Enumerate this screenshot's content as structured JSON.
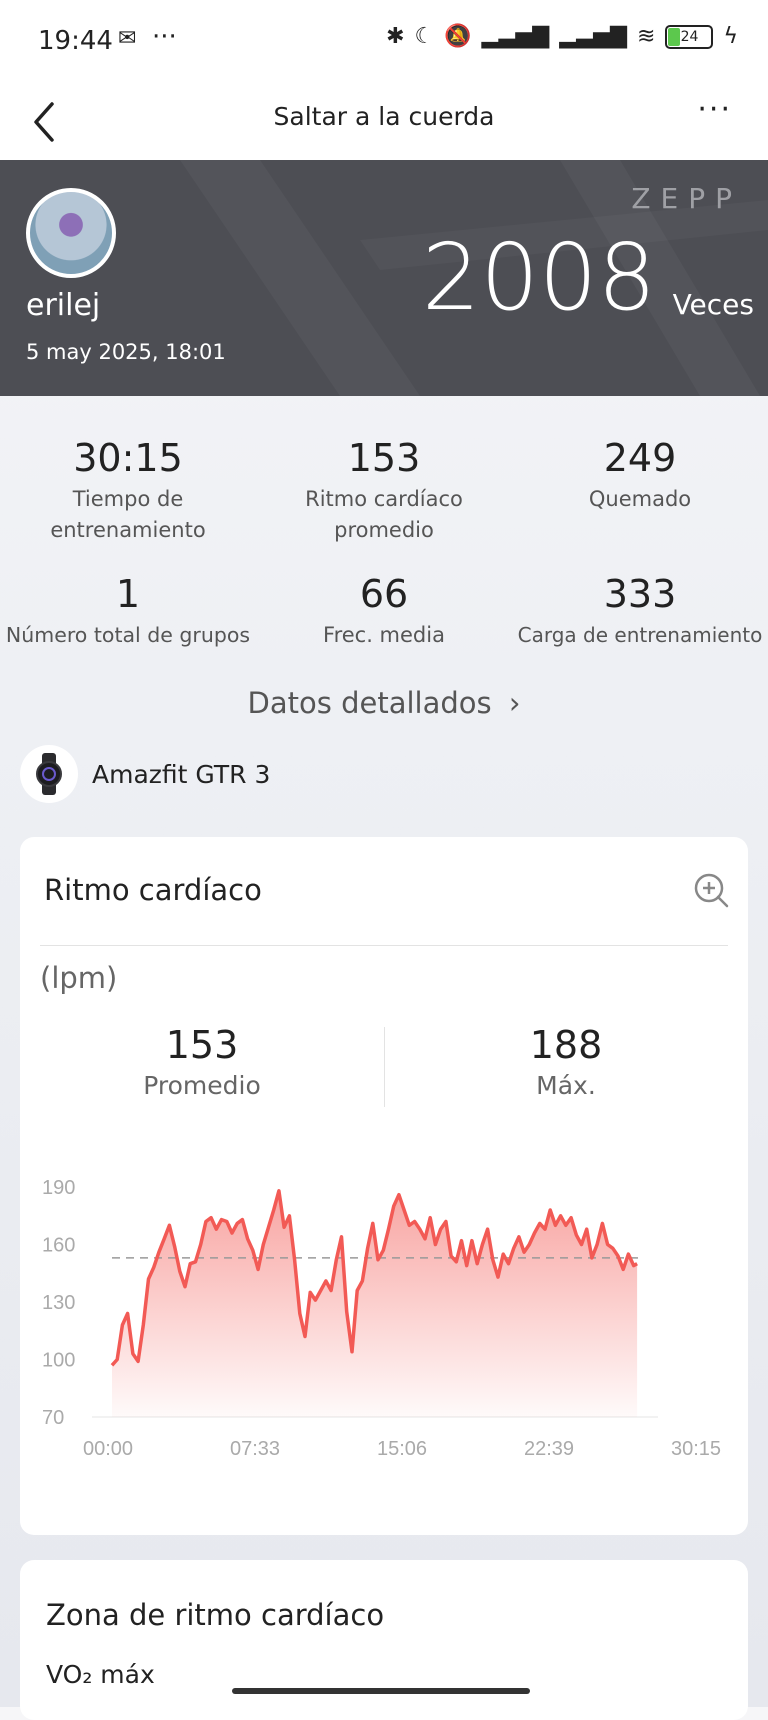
{
  "status_bar": {
    "time": "19:44",
    "notification_icon": "envelope-x-icon",
    "more_icon": "···",
    "battery_level": "24",
    "icons": [
      "bluetooth-icon",
      "moon-icon",
      "mute-icon",
      "signal-icon",
      "signal-icon",
      "wifi-icon",
      "battery-icon",
      "charging-icon"
    ]
  },
  "header": {
    "title": "Saltar a la cuerda",
    "more": "···"
  },
  "banner": {
    "username": "erilej",
    "date": "5 may 2025, 18:01",
    "logo": "ZEPP",
    "count": "2008",
    "count_unit": "Veces"
  },
  "stats": [
    {
      "value": "30:15",
      "label": "Tiempo de entrenamiento"
    },
    {
      "value": "153",
      "label": "Ritmo cardíaco promedio"
    },
    {
      "value": "249",
      "label": "Quemado"
    },
    {
      "value": "1",
      "label": "Número total de grupos"
    },
    {
      "value": "66",
      "label": "Frec. media"
    },
    {
      "value": "333",
      "label": "Carga de entrenamiento"
    }
  ],
  "detail_link": "Datos detallados",
  "device": {
    "name": "Amazfit GTR 3"
  },
  "heart_rate_card": {
    "title": "Ritmo cardíaco",
    "unit": "(lpm)",
    "average_value": "153",
    "average_label": "Promedio",
    "max_value": "188",
    "max_label": "Máx."
  },
  "zone_card": {
    "title": "Zona de ritmo cardíaco",
    "subtitle": "VO₂ máx"
  },
  "colors": {
    "accent": "#f25a55",
    "banner_bg": "#4d4e54"
  },
  "chart_data": {
    "type": "area",
    "ylim": [
      70,
      190
    ],
    "yticks": [
      "190",
      "160",
      "130",
      "100",
      "70"
    ],
    "xticks": [
      "00:00",
      "07:33",
      "15:06",
      "22:39",
      "30:15"
    ],
    "xlim_minutes": [
      0,
      30.25
    ],
    "average_line": 153,
    "series": [
      {
        "x": [
          0.0,
          0.3,
          0.6,
          0.9,
          1.2,
          1.5,
          1.8,
          2.1,
          2.4,
          2.7,
          3.0,
          3.3,
          3.6,
          3.9,
          4.2,
          4.5,
          4.8,
          5.1,
          5.4,
          5.7,
          6.0,
          6.3,
          6.6,
          6.9,
          7.2,
          7.5,
          7.8,
          8.1,
          8.4,
          8.7,
          9.0,
          9.3,
          9.6,
          9.9,
          10.2,
          10.5,
          10.8,
          11.1,
          11.4,
          11.7,
          12.0,
          12.3,
          12.6,
          12.9,
          13.2,
          13.5,
          13.8,
          14.1,
          14.4,
          14.7,
          15.0,
          15.3,
          15.6,
          15.9,
          16.2,
          16.5,
          16.8,
          17.1,
          17.4,
          17.7,
          18.0,
          18.3,
          18.6,
          18.9,
          19.2,
          19.5,
          19.8,
          20.1,
          20.4,
          20.7,
          21.0,
          21.3,
          21.6,
          21.9,
          22.2,
          22.5,
          22.8,
          23.1,
          23.4,
          23.7,
          24.0,
          24.3,
          24.6,
          24.9,
          25.2,
          25.5,
          25.8,
          26.1,
          26.4,
          26.7,
          27.0,
          27.3,
          27.6,
          27.9,
          28.2,
          28.5,
          28.8,
          29.1,
          29.4,
          29.7,
          30.0,
          30.2
        ],
        "y": [
          97,
          100,
          118,
          124,
          103,
          99,
          118,
          142,
          148,
          156,
          163,
          170,
          159,
          146,
          138,
          150,
          151,
          160,
          172,
          174,
          168,
          173,
          172,
          166,
          171,
          173,
          163,
          157,
          147,
          160,
          169,
          178,
          188,
          169,
          175,
          152,
          124,
          112,
          135,
          131,
          136,
          141,
          136,
          152,
          164,
          125,
          104,
          136,
          141,
          158,
          171,
          152,
          157,
          168,
          180,
          186,
          178,
          170,
          172,
          168,
          163,
          174,
          160,
          168,
          172,
          154,
          151,
          162,
          149,
          162,
          150,
          160,
          168,
          152,
          143,
          155,
          150,
          158,
          164,
          156,
          160,
          166,
          171,
          168,
          178,
          170,
          175,
          170,
          174,
          165,
          160,
          168,
          153,
          160,
          171,
          160,
          158,
          154,
          147,
          155,
          149,
          150
        ]
      }
    ]
  }
}
